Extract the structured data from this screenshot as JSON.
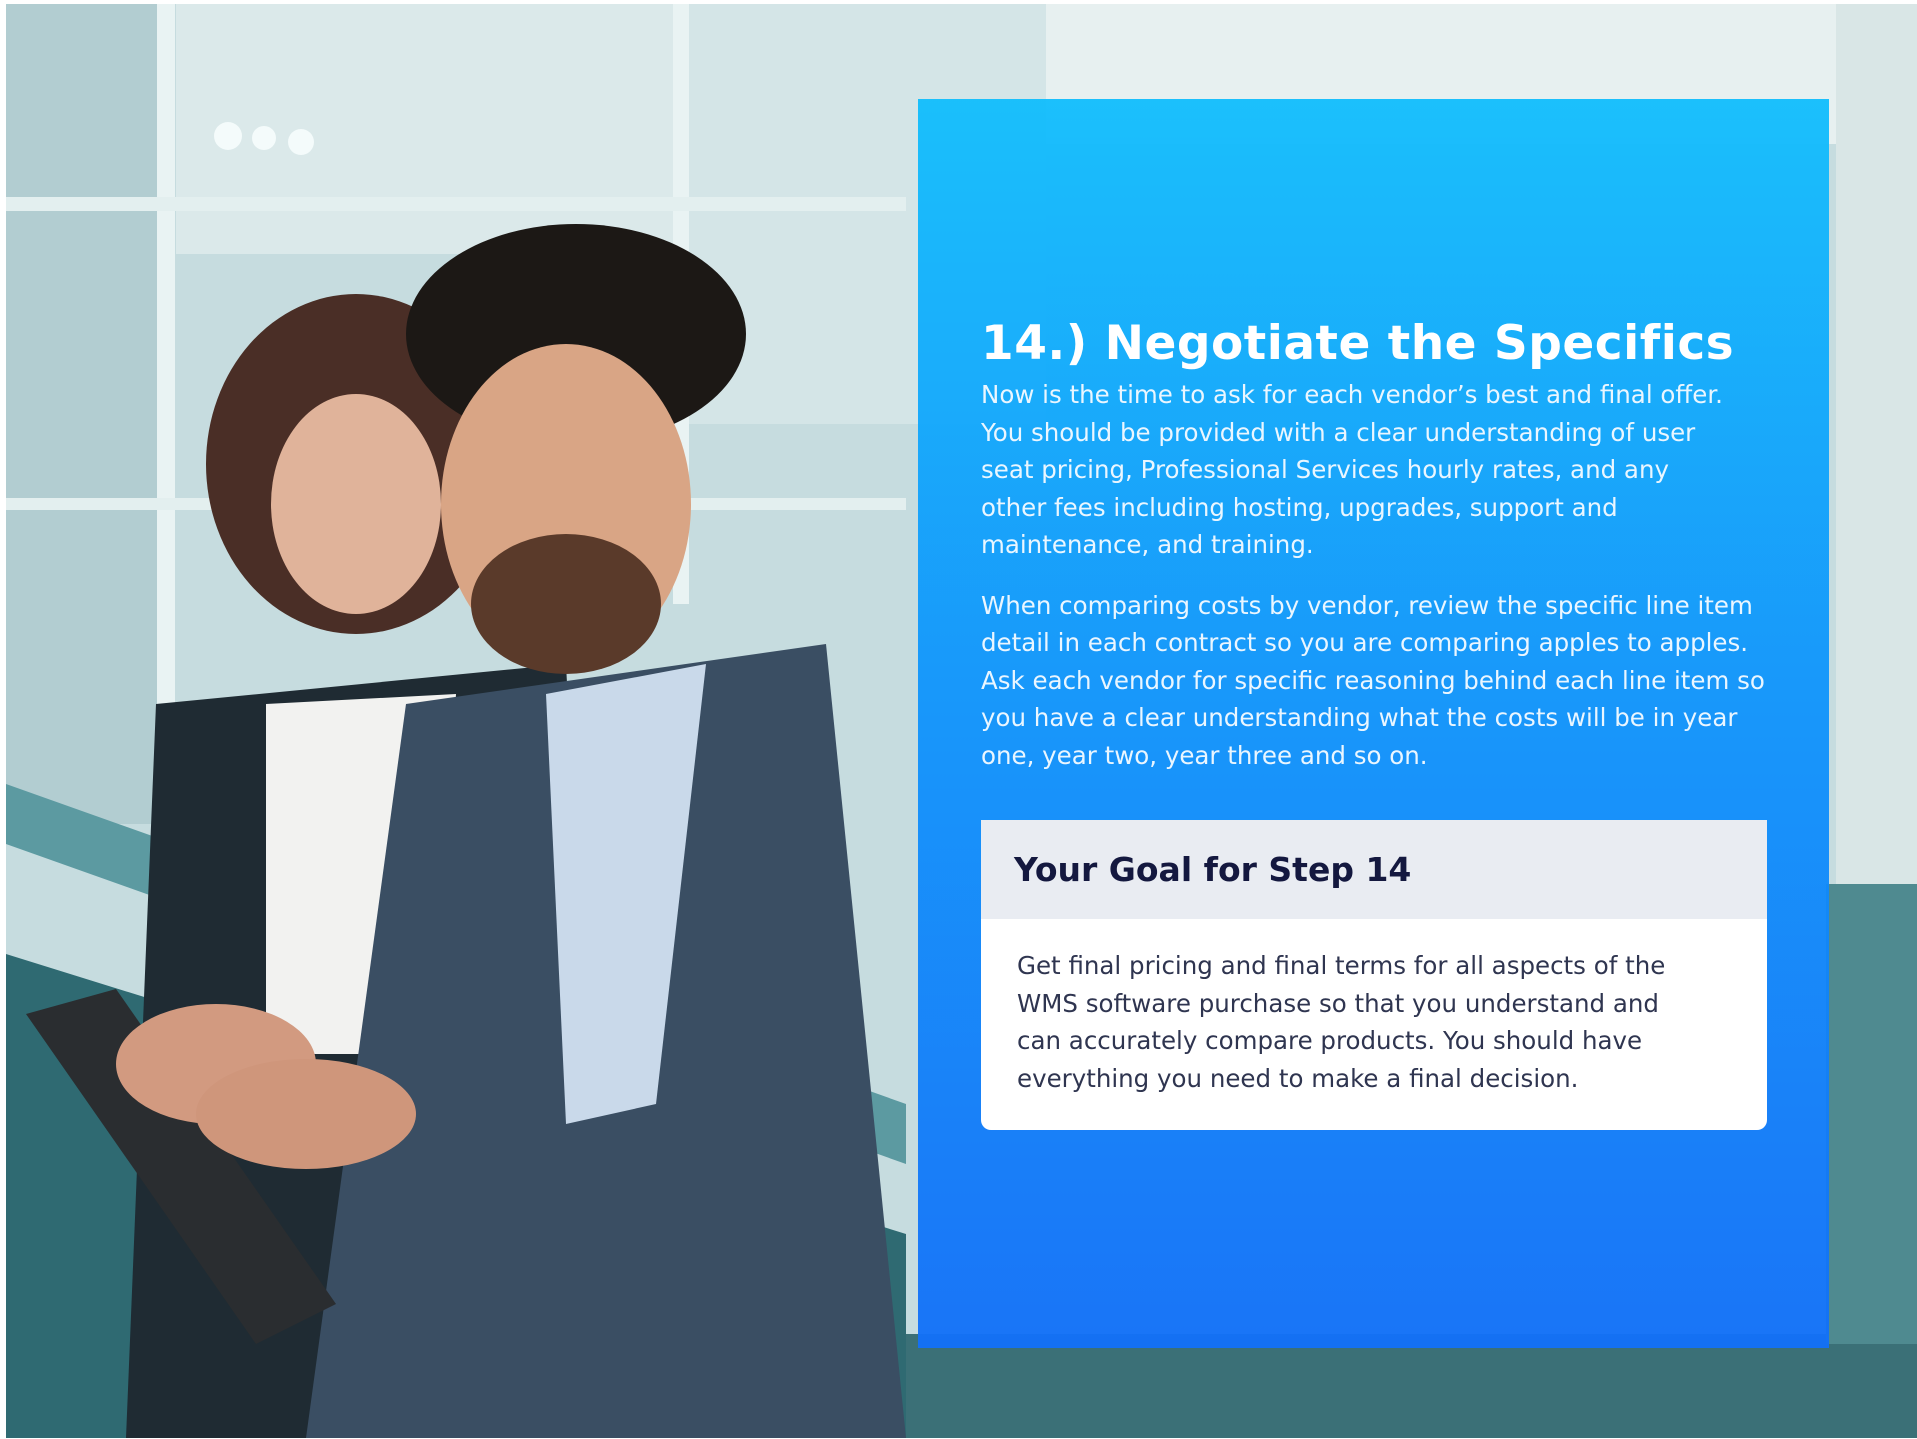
{
  "step": {
    "title": "14.) Negotiate the Specifics",
    "paragraphs": [
      "Now is the time to ask for each vendor’s best and final offer. You should be provided with a clear understanding of user seat pricing, Professional Services hourly rates, and any other fees including hosting, upgrades, support and maintenance, and training.",
      "When comparing costs by vendor, review the specific line item detail in each contract so you are comparing apples to apples. Ask each vendor for specific reasoning behind each line item so you have a clear understanding what the costs will be in year one, year two, year three and so on."
    ]
  },
  "goal": {
    "heading": "Your Goal for Step 14",
    "text": "Get final pricing and final terms for all aspects of the WMS software purchase so that you understand and can accurately compare products. You should have everything you need to make a final decision."
  },
  "colors": {
    "panel_top": "#13befc",
    "panel_bottom": "#1270f8",
    "goal_header_bg": "#e9ecf2",
    "goal_heading": "#14183f",
    "goal_text": "#2f3550"
  }
}
